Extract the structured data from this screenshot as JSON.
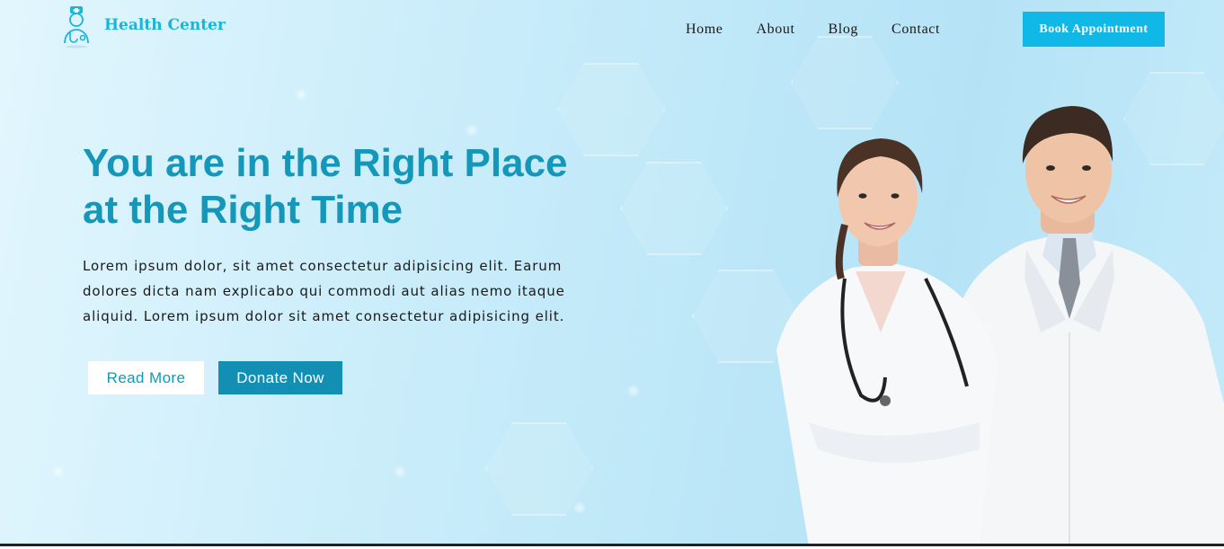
{
  "brand": {
    "name": "Health Center",
    "icon": "doctor-icon",
    "color": "#19b4d8"
  },
  "nav": {
    "items": [
      "Home",
      "About",
      "Blog",
      "Contact"
    ]
  },
  "header": {
    "cta_label": "Book Appointment",
    "cta_color": "#0fb8e6"
  },
  "hero": {
    "headline_line1": "You are in the Right Place",
    "headline_line2": "at the Right Time",
    "paragraph": "Lorem ipsum dolor, sit amet consectetur adipisicing elit. Earum dolores dicta nam explicabo qui commodi aut alias nemo itaque aliquid. Lorem ipsum dolor sit amet consectetur adipisicing elit.",
    "read_more_label": "Read More",
    "donate_label": "Donate Now",
    "headline_color": "#1497b9",
    "image": "doctors-photo"
  }
}
